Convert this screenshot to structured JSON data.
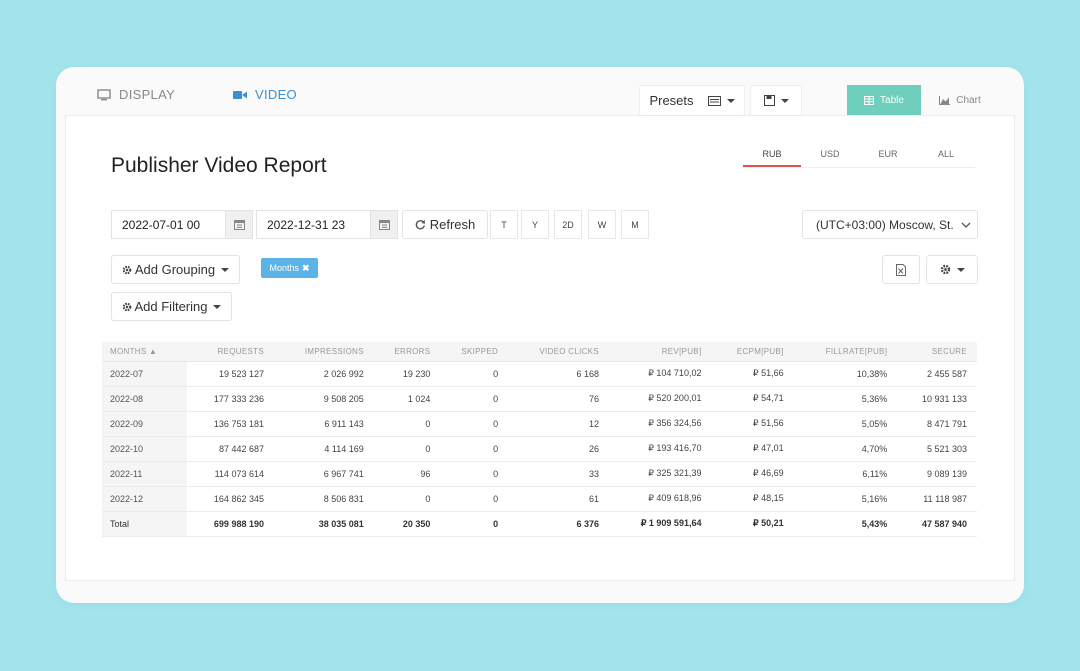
{
  "tabs": {
    "display": "DISPLAY",
    "video": "VIDEO"
  },
  "toolbar": {
    "presets": "Presets",
    "view_table": "Table",
    "view_chart": "Chart"
  },
  "report": {
    "title": "Publisher Video Report"
  },
  "currencies": [
    "RUB",
    "USD",
    "EUR",
    "ALL"
  ],
  "active_currency": "RUB",
  "filters": {
    "date_from": "2022-07-01 00",
    "date_to": "2022-12-31 23",
    "refresh": "Refresh",
    "quick": [
      "T",
      "Y",
      "2D",
      "W",
      "M"
    ],
    "timezone": "(UTC+03:00) Moscow, St.",
    "add_grouping": "Add Grouping",
    "add_filtering": "Add Filtering",
    "grouping_tag": "Months"
  },
  "colors": {
    "accent_blue": "#3d8fd4",
    "table_view": "#6dcfbc",
    "tag": "#5bb3e8",
    "currency_underline": "#d9534f"
  },
  "table": {
    "headers": [
      "MONTHS ▲",
      "REQUESTS",
      "IMPRESSIONS",
      "ERRORS",
      "SKIPPED",
      "VIDEO CLICKS",
      "REV[PUB]",
      "ECPM[PUB]",
      "FILLRATE[PUB]",
      "SECURE"
    ],
    "rows": [
      [
        "2022-07",
        "19 523 127",
        "2 026 992",
        "19 230",
        "0",
        "6 168",
        "₽ 104 710,02",
        "₽ 51,66",
        "10,38%",
        "2 455 587"
      ],
      [
        "2022-08",
        "177 333 236",
        "9 508 205",
        "1 024",
        "0",
        "76",
        "₽ 520 200,01",
        "₽ 54,71",
        "5,36%",
        "10 931 133"
      ],
      [
        "2022-09",
        "136 753 181",
        "6 911 143",
        "0",
        "0",
        "12",
        "₽ 356 324,56",
        "₽ 51,56",
        "5,05%",
        "8 471 791"
      ],
      [
        "2022-10",
        "87 442 687",
        "4 114 169",
        "0",
        "0",
        "26",
        "₽ 193 416,70",
        "₽ 47,01",
        "4,70%",
        "5 521 303"
      ],
      [
        "2022-11",
        "114 073 614",
        "6 967 741",
        "96",
        "0",
        "33",
        "₽ 325 321,39",
        "₽ 46,69",
        "6,11%",
        "9 089 139"
      ],
      [
        "2022-12",
        "164 862 345",
        "8 506 831",
        "0",
        "0",
        "61",
        "₽ 409 618,96",
        "₽ 48,15",
        "5,16%",
        "11 118 987"
      ]
    ],
    "total": [
      "Total",
      "699 988 190",
      "38 035 081",
      "20 350",
      "0",
      "6 376",
      "₽ 1 909 591,64",
      "₽ 50,21",
      "5,43%",
      "47 587 940"
    ]
  }
}
